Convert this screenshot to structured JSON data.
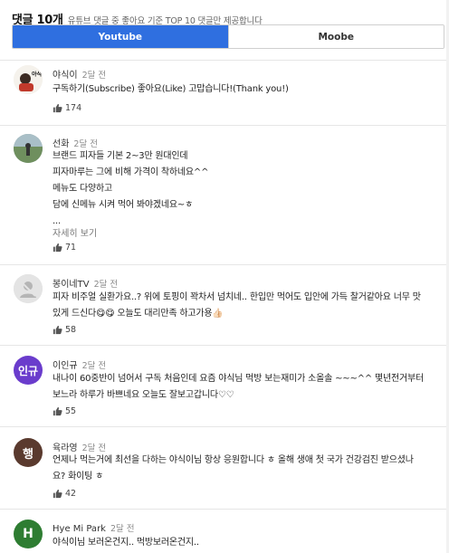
{
  "header": {
    "title": "댓글 10개",
    "subtitle": "유튜브 댓글 중 좋아요 기준 TOP 10 댓글만 제공합니다"
  },
  "tabs": [
    {
      "label": "Youtube"
    },
    {
      "label": "Moobe"
    }
  ],
  "comments": [
    {
      "author": "야식이",
      "time": "2달 전",
      "lines": [
        "구독하기(Subscribe) 좋아요(Like) 고맙습니다!(Thank you!)"
      ],
      "likes": "174"
    },
    {
      "author": "선화",
      "time": "2달 전",
      "lines": [
        "브랜드 피자들 기본 2~3만 원대인데",
        "피자마루는 그에 비해 가격이 착하네요^^",
        "메뉴도 다양하고",
        "담에 신메뉴 시켜 먹어 봐야겠네요~ㅎ",
        "..."
      ],
      "more": "자세히 보기",
      "likes": "71"
    },
    {
      "author": "봉이네TV",
      "time": "2달 전",
      "lines": [
        "피자 비주얼 실환가요..? 위에 토핑이 꽉차서 넘치네.. 한입만 먹어도 입안에 가득 찰거같아요 너무 맛",
        "있게 드신다😋😋 오늘도 대리만족 하고가용👍🏻"
      ],
      "likes": "58"
    },
    {
      "author": "이인규",
      "time": "2달 전",
      "avatar_text": "인규",
      "lines": [
        "내나이 60중반이 넘어서 구독 처음인데 요즘 야식님 먹방 보는재미가 소올솔 ~~~^^ 몇년전거부터",
        "보느라 하루가 바쁘네요 오늘도 잘보고갑니다♡♡"
      ],
      "likes": "55"
    },
    {
      "author": "육라영",
      "time": "2달 전",
      "avatar_text": "행",
      "lines": [
        "언제나 먹는거에 최선을 다하는 야식이님 항상 응원합니다 ㅎ 올해 생애 첫 국가 건강검진 받으셨나",
        "요? 화이팅 ㅎ"
      ],
      "likes": "42"
    },
    {
      "author": "Hye Mi Park",
      "time": "2달 전",
      "avatar_text": "H",
      "lines": [
        "야식이님 보러온건지.. 먹방보러온건지.."
      ]
    }
  ],
  "colors": {
    "tab_active": "#2f6fe0",
    "avatar_inkyu": "#6a3ccc",
    "avatar_haeng": "#5a3a2e",
    "avatar_h": "#2e7d32"
  }
}
